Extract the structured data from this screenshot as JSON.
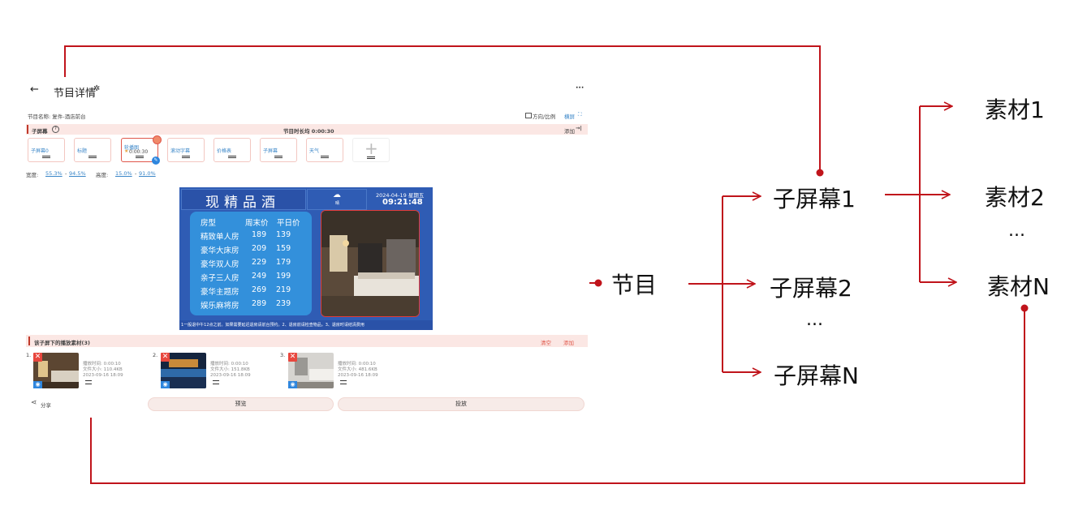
{
  "diagram": {
    "program": "节目",
    "subscreens": [
      "子屏幕1",
      "子屏幕2",
      "子屏幕N"
    ],
    "subscreen_ellipsis": "...",
    "materials": [
      "素材1",
      "素材2",
      "素材N"
    ],
    "material_ellipsis": "...",
    "colors": {
      "connector": "#c0141b"
    }
  },
  "app": {
    "back_icon": "←",
    "title": "节目详情",
    "more_icon": "···",
    "program_name": "节目名称: 复件-酒店前台",
    "orientation_label": "方向/比例",
    "orientation_value": "横屏",
    "subscreen_section": "子屏幕",
    "duration": "节目时长均 0:00:30",
    "add_label": "添加",
    "tiles": [
      "子屏幕0",
      "标题",
      "轮播图",
      "滚动字幕",
      "价格表",
      "子屏幕",
      "天气"
    ],
    "selected_tile_time": "0:00:30",
    "width_label": "宽度:",
    "width_value_1": "55.3%",
    "width_sep": "-",
    "width_value_2": "94.5%",
    "height_label": "高度:",
    "height_value_1": "15.0%",
    "height_sep": "-",
    "height_value_2": "91.0%",
    "preview": {
      "title": "现精品酒",
      "weather_text": "晴",
      "date": "2024-04-19 星期五",
      "time": "09:21:48",
      "table_header": [
        "房型",
        "周末价",
        "平日价"
      ],
      "rows": [
        [
          "精致单人房",
          "189",
          "139"
        ],
        [
          "豪华大床房",
          "209",
          "159"
        ],
        [
          "豪华双人房",
          "229",
          "179"
        ],
        [
          "亲子三人房",
          "249",
          "199"
        ],
        [
          "豪华主题房",
          "269",
          "219"
        ],
        [
          "娱乐麻将房",
          "289",
          "239"
        ]
      ],
      "ticker": "1一般退中午12点之前。如果需要延迟退房请前台预约。2、退房前请检查物品，3、退房时请结清费用"
    },
    "materials_section": "该子屏下的播放素材(3)",
    "clear_label": "清空",
    "add_material_label": "添加",
    "materials": [
      {
        "index": "1.",
        "play": "播放时间: 0:00:10",
        "size": "文件大小: 110.4KB",
        "date": "2023-09-16 18:09"
      },
      {
        "index": "2.",
        "play": "播放时间: 0:00:10",
        "size": "文件大小: 151.8KB",
        "date": "2023-09-16 18:09"
      },
      {
        "index": "3.",
        "play": "播放时间: 0:00:10",
        "size": "文件大小: 481.6KB",
        "date": "2023-09-16 18:09"
      }
    ],
    "share_label": "分享",
    "preview_button": "预览",
    "cast_button": "投放"
  }
}
